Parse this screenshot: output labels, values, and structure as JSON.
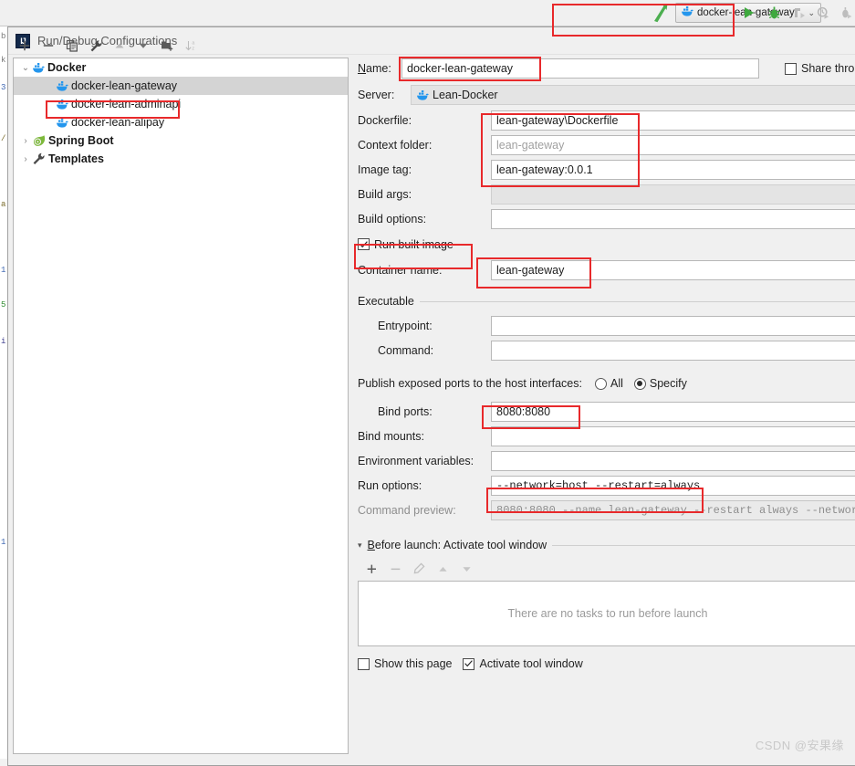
{
  "ide_toolbar": {
    "cursor_icon": "arrow-cursor-icon",
    "run_config_selector": {
      "icon": "docker-whale-icon",
      "label": "docker-lean-gateway",
      "caret": "⌄"
    },
    "buttons": [
      {
        "name": "run-button",
        "icon": "play-triangle-icon",
        "enabled": true
      },
      {
        "name": "debug-button",
        "icon": "bug-icon",
        "enabled": true
      },
      {
        "name": "run-with-coverage-button",
        "icon": "coverage-icon",
        "enabled": false
      },
      {
        "name": "profile-button",
        "icon": "profiler-clock-icon",
        "enabled": false
      },
      {
        "name": "attach-debugger-button",
        "icon": "attach-process-icon",
        "enabled": false
      }
    ]
  },
  "dialog": {
    "title": "Run/Debug Configurations",
    "logo_text": "IJ"
  },
  "tree_toolbar": {
    "buttons": [
      {
        "name": "add-configuration-button",
        "glyph": "+",
        "enabled": true
      },
      {
        "name": "remove-configuration-button",
        "glyph": "−",
        "enabled": true
      },
      {
        "name": "copy-configuration-button",
        "glyph": "copy-icon",
        "enabled": true
      },
      {
        "name": "edit-templates-button",
        "glyph": "wrench-icon",
        "enabled": true
      },
      {
        "name": "move-up-button",
        "glyph": "▲",
        "enabled": false
      },
      {
        "name": "move-down-button",
        "glyph": "▼",
        "enabled": true
      },
      {
        "name": "new-folder-button",
        "glyph": "folder-add-icon",
        "enabled": true
      },
      {
        "name": "sort-configurations-button",
        "glyph": "sort-az-icon",
        "enabled": false
      }
    ]
  },
  "tree": {
    "nodes": [
      {
        "label": "Docker",
        "icon": "docker-whale-icon",
        "expanded": true,
        "twisty": "⌄",
        "children": [
          {
            "label": "docker-lean-gateway",
            "icon": "docker-whale-icon",
            "selected": true
          },
          {
            "label": "docker-lean-adminapi",
            "icon": "docker-whale-icon",
            "selected": false
          },
          {
            "label": "docker-lean-alipay",
            "icon": "docker-whale-icon",
            "selected": false
          }
        ]
      },
      {
        "label": "Spring Boot",
        "icon": "spring-leaf-icon",
        "expanded": false,
        "twisty": "›",
        "children": []
      },
      {
        "label": "Templates",
        "icon": "wrench-icon",
        "expanded": false,
        "twisty": "›",
        "children": []
      }
    ]
  },
  "form": {
    "name": {
      "label": "Name:",
      "value": "docker-lean-gateway"
    },
    "share": {
      "label": "Share thro",
      "checked": false
    },
    "server": {
      "label": "Server:",
      "value": "Lean-Docker",
      "icon": "docker-whale-icon"
    },
    "dockerfile": {
      "label": "Dockerfile:",
      "value": "lean-gateway\\Dockerfile"
    },
    "context_folder": {
      "label": "Context folder:",
      "placeholder": "lean-gateway",
      "value": ""
    },
    "image_tag": {
      "label": "Image tag:",
      "value": "lean-gateway:0.0.1"
    },
    "build_args": {
      "label": "Build args:",
      "value": ""
    },
    "build_options": {
      "label": "Build options:",
      "value": ""
    },
    "run_built_image": {
      "label": "Run built image",
      "checked": true
    },
    "container_name": {
      "label": "Container name:",
      "value": "lean-gateway"
    },
    "executable_section": {
      "label": "Executable"
    },
    "entrypoint": {
      "label": "Entrypoint:",
      "value": ""
    },
    "command": {
      "label": "Command:",
      "value": ""
    },
    "publish_ports": {
      "label": "Publish exposed ports to the host interfaces:",
      "options": [
        "All",
        "Specify"
      ],
      "selected": "Specify"
    },
    "bind_ports": {
      "label": "Bind ports:",
      "value": "8080:8080"
    },
    "bind_mounts": {
      "label": "Bind mounts:",
      "value": ""
    },
    "environment_variables": {
      "label": "Environment variables:",
      "value": ""
    },
    "run_options": {
      "label": "Run options:",
      "value": "--network=host --restart=always"
    },
    "command_preview": {
      "label": "Command preview:",
      "value": "8080:8080 --name lean-gateway --restart always --networ"
    },
    "before_launch": {
      "label": "Before launch: Activate tool window",
      "twisty": "▾",
      "toolbar": [
        {
          "name": "add-task-button",
          "glyph": "+",
          "enabled": true
        },
        {
          "name": "remove-task-button",
          "glyph": "−",
          "enabled": false
        },
        {
          "name": "edit-task-button",
          "glyph": "pencil-icon",
          "enabled": false
        },
        {
          "name": "move-task-up-button",
          "glyph": "▲",
          "enabled": false
        },
        {
          "name": "move-task-down-button",
          "glyph": "▼",
          "enabled": false
        }
      ],
      "empty_text": "There are no tasks to run before launch",
      "show_this_page": {
        "label": "Show this page",
        "checked": false
      },
      "activate_tool_window": {
        "label": "Activate tool window",
        "checked": true
      }
    }
  },
  "watermark": "CSDN @安果缘",
  "colors": {
    "annotation_red": "#e8292b",
    "docker_blue": "#2496ed",
    "run_green": "#3ea93e",
    "selection_gray": "#d4d4d4"
  }
}
